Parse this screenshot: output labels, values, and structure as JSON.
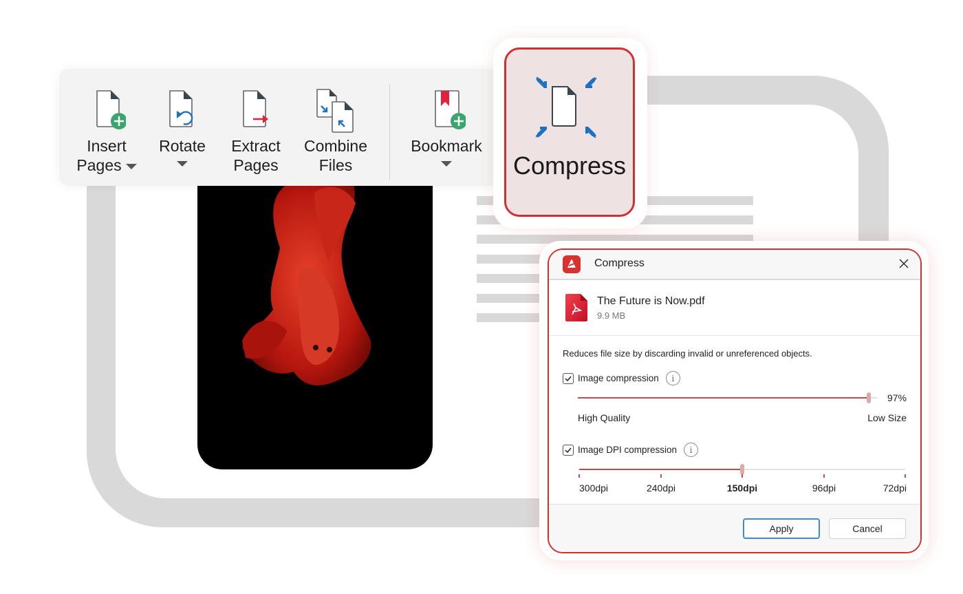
{
  "colors": {
    "accent_red": "#d32f2f",
    "icon_blue": "#1d72c2",
    "icon_green": "#3aa66d",
    "frame_gray": "#d9d9d9"
  },
  "ribbon": {
    "items": [
      {
        "label_line1": "Insert",
        "label_line2": "Pages",
        "icon": "insert-pages-icon",
        "has_dropdown": true
      },
      {
        "label_line1": "Rotate",
        "label_line2": "",
        "icon": "rotate-icon",
        "has_dropdown": true
      },
      {
        "label_line1": "Extract",
        "label_line2": "Pages",
        "icon": "extract-pages-icon",
        "has_dropdown": false
      },
      {
        "label_line1": "Combine",
        "label_line2": "Files",
        "icon": "combine-files-icon",
        "has_dropdown": false
      },
      {
        "label_line1": "Bookmark",
        "label_line2": "",
        "icon": "bookmark-icon",
        "has_dropdown": true
      }
    ],
    "compress": {
      "label": "Compress",
      "icon": "compress-icon",
      "selected": true
    }
  },
  "document": {
    "image": "red-betta-fish-photo",
    "text_lines": 7
  },
  "dialog": {
    "title": "Compress",
    "close_icon": "close-icon",
    "file": {
      "name": "The Future is Now.pdf",
      "size": "9.9 MB",
      "icon": "pdf-file-icon"
    },
    "description": "Reduces file size by discarding invalid or unreferenced objects.",
    "image_compression": {
      "label": "Image compression",
      "checked": true,
      "value_percent": 97,
      "value_label": "97%",
      "min_label": "High Quality",
      "max_label": "Low Size"
    },
    "dpi_compression": {
      "label": "Image DPI compression",
      "checked": true,
      "options": [
        "300dpi",
        "240dpi",
        "150dpi",
        "96dpi",
        "72dpi"
      ],
      "selected_index": 2,
      "selected": "150dpi"
    },
    "buttons": {
      "apply": "Apply",
      "cancel": "Cancel"
    }
  }
}
